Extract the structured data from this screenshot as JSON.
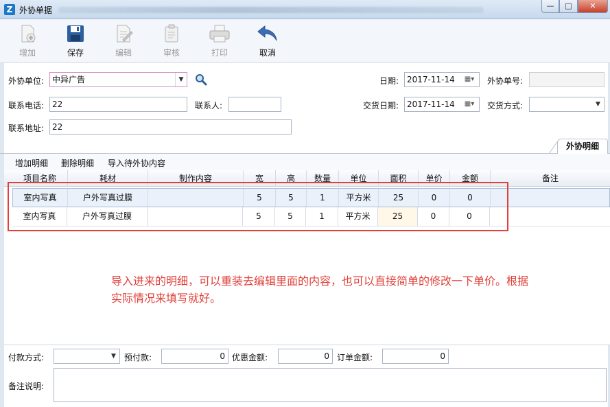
{
  "window": {
    "title": "外协单据",
    "controls": [
      "—",
      "□",
      "✕"
    ]
  },
  "toolbar": {
    "add_label": "增加",
    "save_label": "保存",
    "edit_label": "编辑",
    "audit_label": "审核",
    "print_label": "打印",
    "cancel_label": "取消"
  },
  "form": {
    "vendor_label": "外协单位:",
    "vendor_value": "中异广告",
    "date_label": "日期:",
    "date_value": "2017-11-14",
    "order_no_label": "外协单号:",
    "order_no_value": "",
    "phone_label": "联系电话:",
    "phone_value": "22",
    "contact_label": "联系人:",
    "contact_value": "",
    "delivery_date_label": "交货日期:",
    "delivery_date_value": "2017-11-14",
    "delivery_method_label": "交货方式:",
    "delivery_method_value": "",
    "address_label": "联系地址:",
    "address_value": "22"
  },
  "tab": {
    "label": "外协明细"
  },
  "detail_toolbar": {
    "add_detail": "增加明细",
    "delete_detail": "删除明细",
    "import_pending": "导入待外协内容"
  },
  "grid": {
    "columns": [
      "项目名称",
      "耗材",
      "制作内容",
      "宽",
      "高",
      "数量",
      "单位",
      "面积",
      "单价",
      "金额",
      "备注"
    ],
    "rows": [
      {
        "project": "室内写真",
        "material": "户外写真过膜",
        "content": "",
        "width": "5",
        "height": "5",
        "qty": "1",
        "unit": "平方米",
        "area": "25",
        "price": "0",
        "amount": "0",
        "note": ""
      },
      {
        "project": "室内写真",
        "material": "户外写真过膜",
        "content": "",
        "width": "5",
        "height": "5",
        "qty": "1",
        "unit": "平方米",
        "area": "25",
        "price": "0",
        "amount": "0",
        "note": ""
      }
    ]
  },
  "annotation": "导入进来的明细，可以重装去编辑里面的内容，也可以直接简单的修改一下单价。根据实际情况来填写就好。",
  "footer": {
    "payment_label": "付款方式:",
    "payment_value": "",
    "prepay_label": "预付款:",
    "prepay_value": "0",
    "discount_label": "优惠金额:",
    "discount_value": "0",
    "order_amount_label": "订单金额:",
    "order_amount_value": "0",
    "remark_label": "备注说明:",
    "remark_value": ""
  },
  "colors": {
    "highlight_red": "#e0403a",
    "accent_blue": "#1b78c8"
  }
}
